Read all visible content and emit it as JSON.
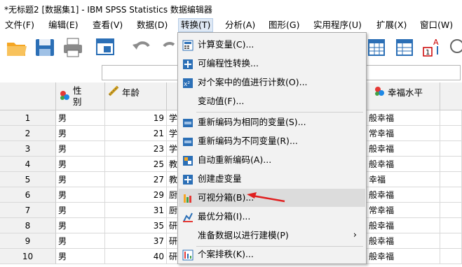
{
  "window": {
    "title": "*无标题2 [数据集1] - IBM SPSS Statistics 数据编辑器"
  },
  "menu": [
    "文件(F)",
    "编辑(E)",
    "查看(V)",
    "数据(D)",
    "转换(T)",
    "分析(A)",
    "图形(G)",
    "实用程序(U)",
    "扩展(X)",
    "窗口(W)"
  ],
  "colors": {
    "accent_red": "#e02020",
    "highlight": "#dcdcdc",
    "menu_bg": "#f2f2f2"
  },
  "toolbar_icons": [
    "open-folder-icon",
    "save-icon",
    "print-icon",
    "dialog-recall-icon",
    "undo-icon",
    "redo-icon",
    "table-icon",
    "table-icon-2",
    "weight-cases-icon",
    "value-labels-icon"
  ],
  "columns": [
    {
      "label": "性别",
      "icon": "nominal-variable-icon"
    },
    {
      "label": "年龄",
      "icon": "scale-variable-icon"
    },
    {
      "label": "幸福水平",
      "icon": "nominal-variable-icon"
    }
  ],
  "rows": [
    {
      "n": "1",
      "gender": "男",
      "age": "19",
      "c3": "学",
      "happy": "般幸福"
    },
    {
      "n": "2",
      "gender": "男",
      "age": "21",
      "c3": "学",
      "happy": "常幸福"
    },
    {
      "n": "3",
      "gender": "男",
      "age": "23",
      "c3": "学",
      "happy": "般幸福"
    },
    {
      "n": "4",
      "gender": "男",
      "age": "25",
      "c3": "教",
      "happy": "般幸福"
    },
    {
      "n": "5",
      "gender": "男",
      "age": "27",
      "c3": "教",
      "happy": "幸福"
    },
    {
      "n": "6",
      "gender": "男",
      "age": "29",
      "c3": "厨",
      "happy": "般幸福"
    },
    {
      "n": "7",
      "gender": "男",
      "age": "31",
      "c3": "厨",
      "happy": "常幸福"
    },
    {
      "n": "8",
      "gender": "男",
      "age": "35",
      "c3": "研",
      "happy": "般幸福"
    },
    {
      "n": "9",
      "gender": "男",
      "age": "37",
      "c3": "研",
      "happy": "般幸福"
    },
    {
      "n": "10",
      "gender": "男",
      "age": "40",
      "c3": "研",
      "happy": "般幸福"
    }
  ],
  "transform_menu": [
    {
      "label": "计算变量(C)...",
      "icon": "compute-icon"
    },
    {
      "label": "可编程性转换...",
      "icon": "plus-icon"
    },
    {
      "label": "对个案中的值进行计数(O)...",
      "icon": "count-values-icon"
    },
    {
      "label": "变动值(F)...",
      "icon": ""
    },
    {
      "label": "重新编码为相同的变量(S)...",
      "icon": "recode-icon"
    },
    {
      "label": "重新编码为不同变量(R)...",
      "icon": "recode-icon"
    },
    {
      "label": "自动重新编码(A)...",
      "icon": "auto-recode-icon"
    },
    {
      "label": "创建虚变量",
      "icon": "plus-icon"
    },
    {
      "label": "可视分箱(B)...",
      "icon": "visual-binning-icon"
    },
    {
      "label": "最优分箱(I)...",
      "icon": "optimal-binning-icon"
    },
    {
      "label": "准备数据以进行建模(P)",
      "icon": "",
      "submenu": true
    },
    {
      "label": "个案排秩(K)...",
      "icon": "rank-cases-icon"
    }
  ]
}
